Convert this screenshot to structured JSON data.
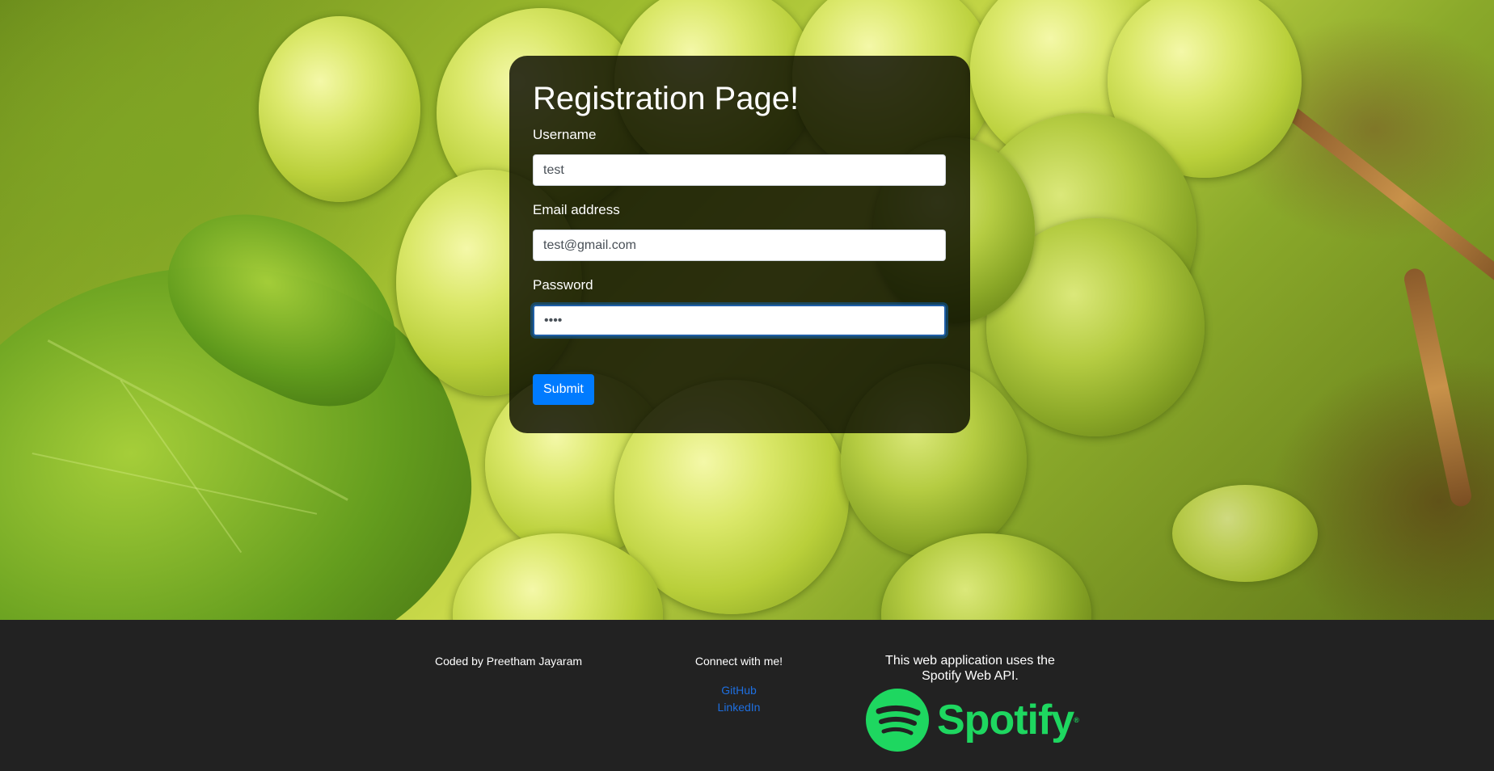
{
  "form": {
    "title": "Registration Page!",
    "username_label": "Username",
    "username_value": "test",
    "email_label": "Email address",
    "email_value": "test@gmail.com",
    "password_label": "Password",
    "password_value": "••••",
    "submit_label": "Submit"
  },
  "footer": {
    "credit": "Coded by Preetham Jayaram",
    "connect_heading": "Connect with me!",
    "links": [
      "GitHub",
      "LinkedIn"
    ],
    "api_note": "This web application uses the Spotify Web API.",
    "spotify_wordmark": "Spotify",
    "registered_mark": "®"
  },
  "colors": {
    "submit_button": "#007bff",
    "link": "#1e6fe0",
    "spotify_green": "#1ed760",
    "footer_bg": "#222222"
  },
  "icons": {
    "spotify_logo": "spotify-logo-icon"
  }
}
